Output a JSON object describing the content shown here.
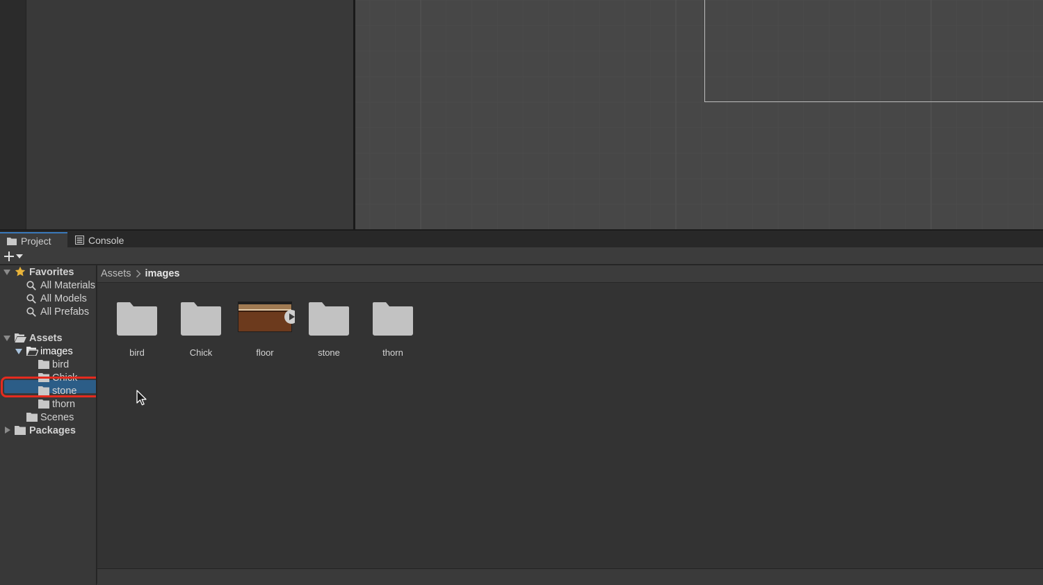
{
  "tabs": {
    "project_label": "Project",
    "console_label": "Console"
  },
  "tree": {
    "favorites": {
      "label": "Favorites",
      "items": [
        "All Materials",
        "All Models",
        "All Prefabs"
      ]
    },
    "assets": {
      "label": "Assets",
      "images": {
        "label": "images",
        "children": [
          "bird",
          "Chick",
          "stone",
          "thorn"
        ]
      },
      "scenes_label": "Scenes"
    },
    "packages_label": "Packages"
  },
  "breadcrumb": {
    "root": "Assets",
    "current": "images"
  },
  "assets_grid": [
    {
      "name": "bird",
      "kind": "folder"
    },
    {
      "name": "Chick",
      "kind": "folder"
    },
    {
      "name": "floor",
      "kind": "sprite"
    },
    {
      "name": "stone",
      "kind": "folder"
    },
    {
      "name": "thorn",
      "kind": "folder"
    }
  ],
  "colors": {
    "selection": "#2c5d87",
    "highlight_ring": "#e52b1f",
    "folder": "#c2c2c2",
    "favorites_star": "#e9b43a",
    "floor_sprite_top": "#a07a52",
    "floor_sprite_body": "#6c3a1d"
  }
}
